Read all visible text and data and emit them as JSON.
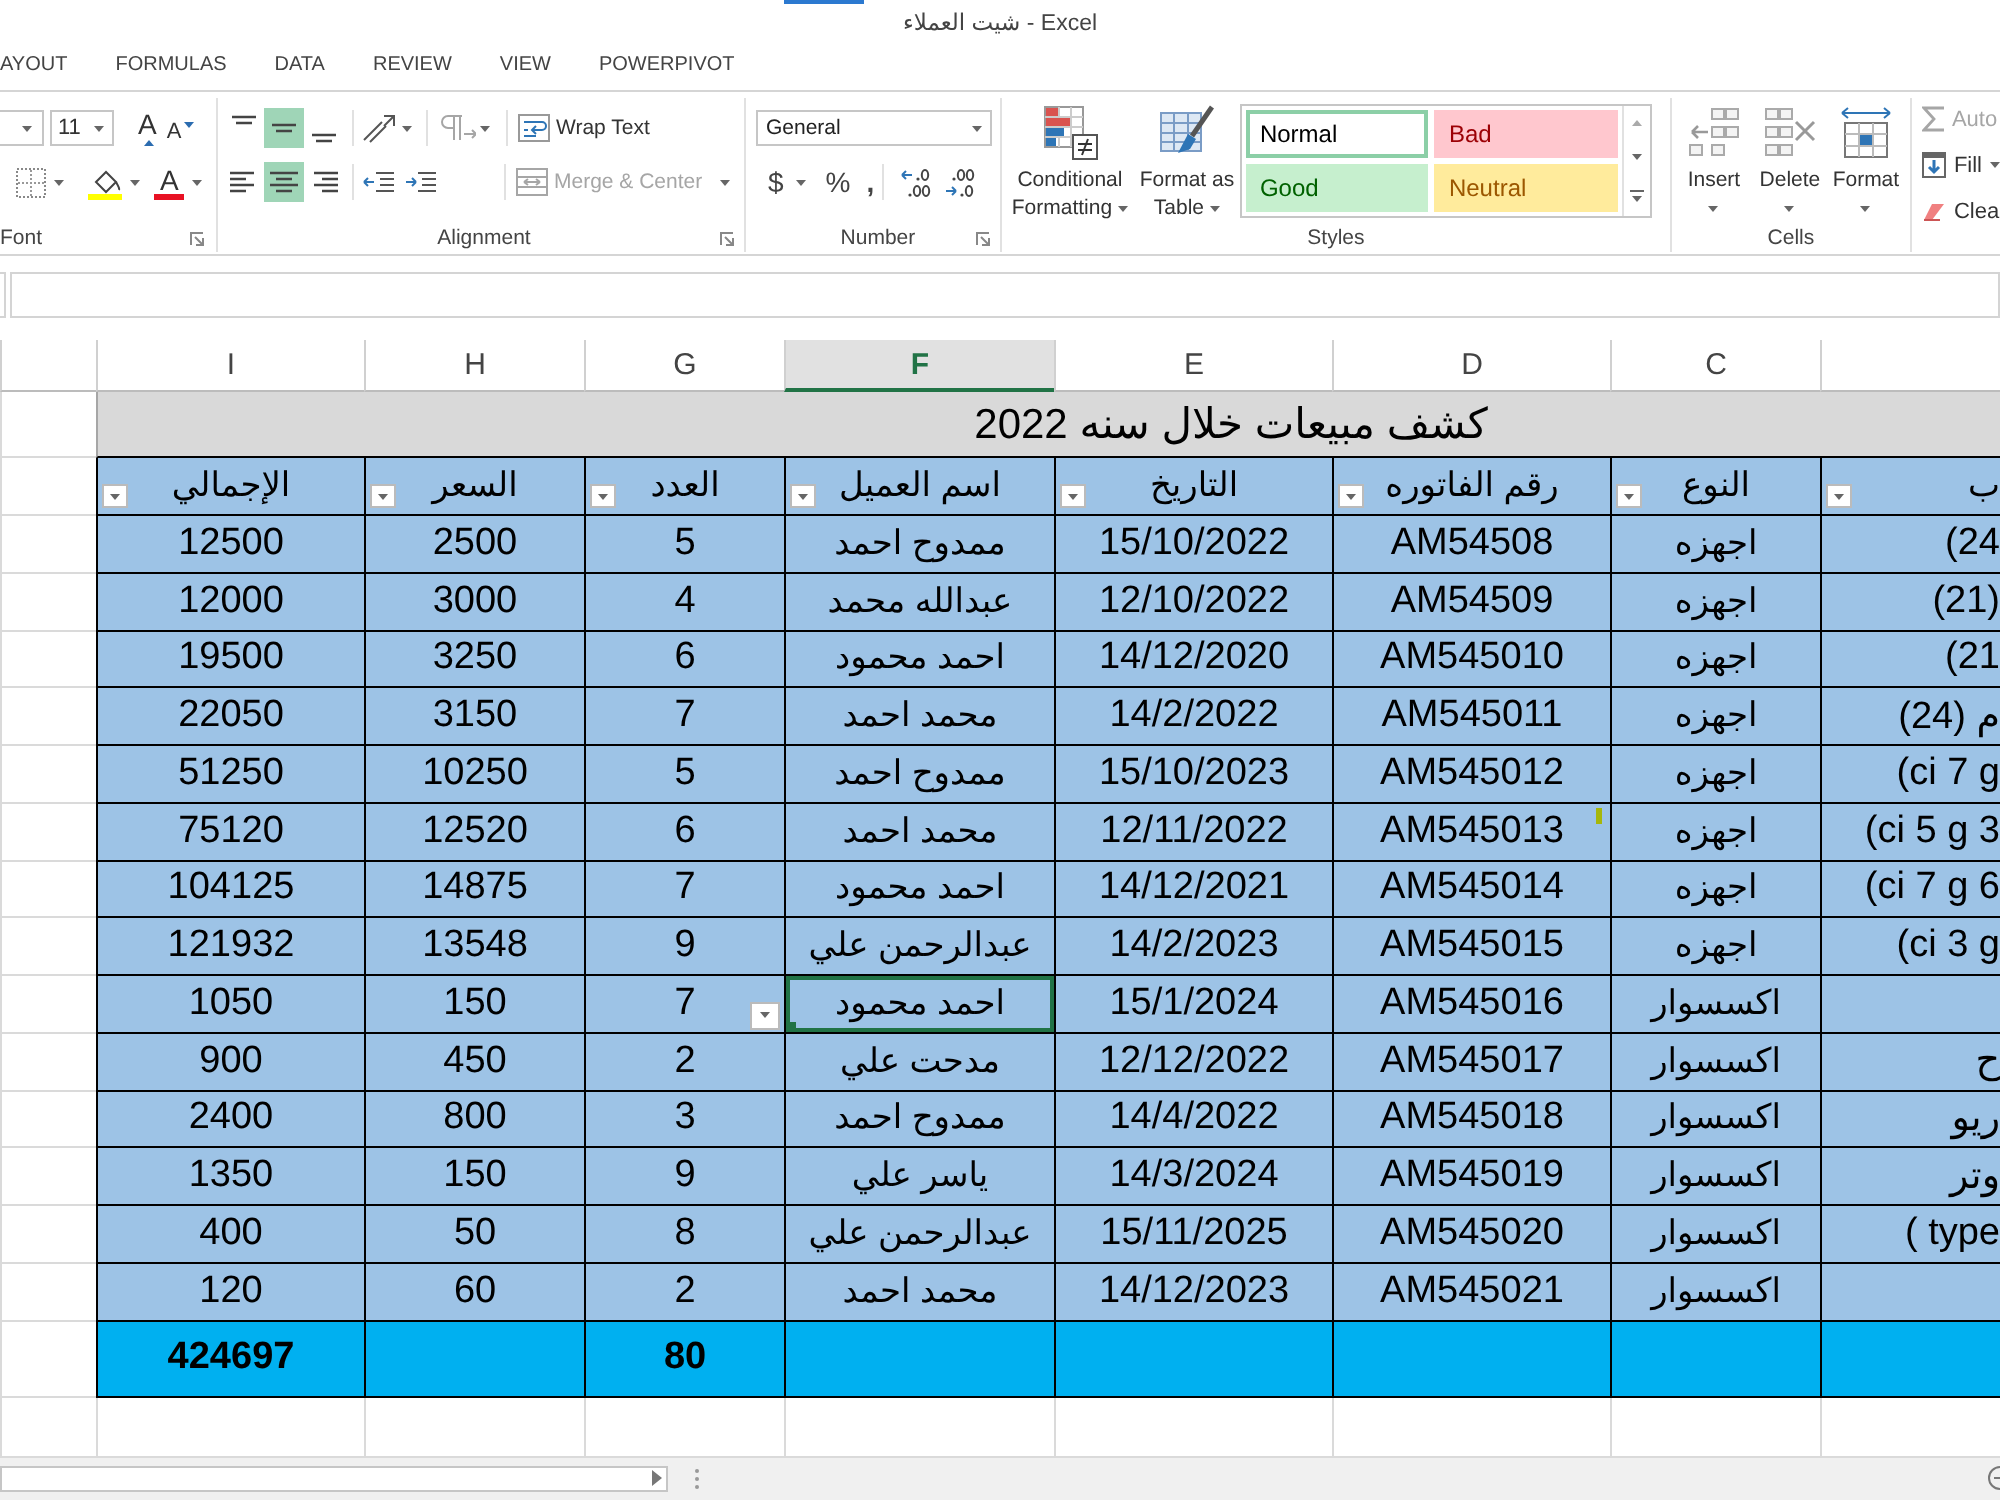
{
  "window": {
    "title": "شيت العملاء - Excel"
  },
  "ribbon_tabs": [
    {
      "label": "POWERPIVOT",
      "selected": false
    },
    {
      "label": "VIEW",
      "selected": false
    },
    {
      "label": "REVIEW",
      "selected": false
    },
    {
      "label": "DATA",
      "selected": false
    },
    {
      "label": "FORMULAS",
      "selected": false
    },
    {
      "label": "AYOUT",
      "selected": false
    }
  ],
  "ribbon": {
    "font": {
      "size": "11",
      "grow_glyph": "A",
      "shrink_glyph": "A",
      "color_glyph": "A",
      "label": "Font"
    },
    "alignment": {
      "vertical": [
        {
          "kind": "top",
          "selected": false
        },
        {
          "kind": "middle",
          "selected": true
        },
        {
          "kind": "bottom",
          "selected": false
        }
      ],
      "horizontal": [
        {
          "kind": "left",
          "selected": false
        },
        {
          "kind": "center",
          "selected": true
        },
        {
          "kind": "right",
          "selected": false
        }
      ],
      "text_direction": {
        "disabled": true
      },
      "wrap_text": "Wrap Text",
      "merge_center": {
        "label": "Merge & Center",
        "disabled": true
      },
      "label": "Alignment"
    },
    "number": {
      "format": "General",
      "currency": "$",
      "percent": "%",
      "comma": ",",
      "label": "Number"
    },
    "styles": {
      "conditional_formatting": [
        "Conditional",
        "Formatting"
      ],
      "format_as_table": [
        "Format as",
        "Table"
      ],
      "gallery": [
        {
          "label": "Bad",
          "kind": "bad",
          "selected": false
        },
        {
          "label": "Normal",
          "kind": "normal",
          "selected": true
        },
        {
          "label": "Neutral",
          "kind": "neutral",
          "selected": false
        },
        {
          "label": "Good",
          "kind": "good",
          "selected": false
        }
      ],
      "label": "Styles"
    },
    "cells": {
      "buttons": [
        {
          "label": "Format",
          "kind": "format"
        },
        {
          "label": "Delete",
          "kind": "delete"
        },
        {
          "label": "Insert",
          "kind": "insert"
        }
      ],
      "label": "Cells"
    },
    "editing": {
      "autosum": {
        "label": "Auto",
        "disabled": true
      },
      "fill": "Fill",
      "clear": "Clea"
    }
  },
  "sheet": {
    "columns": [
      {
        "letter": "C",
        "selected": false
      },
      {
        "letter": "D",
        "selected": false
      },
      {
        "letter": "E",
        "selected": false
      },
      {
        "letter": "F",
        "selected": true
      },
      {
        "letter": "G",
        "selected": false
      },
      {
        "letter": "H",
        "selected": false
      },
      {
        "letter": "I",
        "selected": false
      }
    ],
    "title": "كشف مبيعات خلال سنه 2022",
    "headers": [
      "ب",
      "النوع",
      "رقم الفاتوره",
      "التاريخ",
      "اسم العميل",
      "العدد",
      "السعر",
      "الإجمالي"
    ],
    "rows": [
      {
        "column_b": "(24",
        "type": "اجهزه",
        "invoice_number": "AM54508",
        "date": "15/10/2022",
        "customer_name": "ممدوح احمد",
        "count": "5",
        "price": "2500",
        "total": "12500",
        "selected": false,
        "error_mark": false
      },
      {
        "column_b": "(21)",
        "type": "اجهزه",
        "invoice_number": "AM54509",
        "date": "12/10/2022",
        "customer_name": "عبدالله محمد",
        "count": "4",
        "price": "3000",
        "total": "12000",
        "selected": false,
        "error_mark": false
      },
      {
        "column_b": "(21",
        "type": "اجهزه",
        "invoice_number": "AM545010",
        "date": "14/12/2020",
        "customer_name": "احمد محمود",
        "count": "6",
        "price": "3250",
        "total": "19500",
        "selected": false,
        "error_mark": false
      },
      {
        "column_b": "م (24)",
        "type": "اجهزه",
        "invoice_number": "AM545011",
        "date": "14/2/2022",
        "customer_name": "محمد احمد",
        "count": "7",
        "price": "3150",
        "total": "22050",
        "selected": false,
        "error_mark": false
      },
      {
        "column_b": "(ci 7 g",
        "type": "اجهزه",
        "invoice_number": "AM545012",
        "date": "15/10/2023",
        "customer_name": "ممدوح احمد",
        "count": "5",
        "price": "10250",
        "total": "51250",
        "selected": false,
        "error_mark": false
      },
      {
        "column_b": "(ci 5 g 3",
        "type": "اجهزه",
        "invoice_number": "AM545013",
        "date": "12/11/2022",
        "customer_name": "محمد احمد",
        "count": "6",
        "price": "12520",
        "total": "75120",
        "selected": false,
        "error_mark": true
      },
      {
        "column_b": "(ci 7 g 6",
        "type": "اجهزه",
        "invoice_number": "AM545014",
        "date": "14/12/2021",
        "customer_name": "احمد محمود",
        "count": "7",
        "price": "14875",
        "total": "104125",
        "selected": false,
        "error_mark": false
      },
      {
        "column_b": "(ci 3 g",
        "type": "اجهزه",
        "invoice_number": "AM545015",
        "date": "14/2/2023",
        "customer_name": "عبدالرحمن علي",
        "count": "9",
        "price": "13548",
        "total": "121932",
        "selected": false,
        "error_mark": false
      },
      {
        "type": "اكسسوار",
        "invoice_number": "AM545016",
        "date": "15/1/2024",
        "customer_name": "احمد محمود",
        "count": "7",
        "price": "150",
        "total": "1050",
        "selected": true,
        "error_mark": false
      },
      {
        "column_b": "ح",
        "type": "اكسسوار",
        "invoice_number": "AM545017",
        "date": "12/12/2022",
        "customer_name": "مدحت علي",
        "count": "2",
        "price": "450",
        "total": "900",
        "selected": false,
        "error_mark": false
      },
      {
        "column_b": "ريو",
        "type": "اكسسوار",
        "invoice_number": "AM545018",
        "date": "14/4/2022",
        "customer_name": "ممدوح احمد",
        "count": "3",
        "price": "800",
        "total": "2400",
        "selected": false,
        "error_mark": false
      },
      {
        "column_b": "وتر",
        "type": "اكسسوار",
        "invoice_number": "AM545019",
        "date": "14/3/2024",
        "customer_name": "ياسر علي",
        "count": "9",
        "price": "150",
        "total": "1350",
        "selected": false,
        "error_mark": false
      },
      {
        "column_b": "( type",
        "type": "اكسسوار",
        "invoice_number": "AM545020",
        "date": "15/11/2025",
        "customer_name": "عبدالرحمن علي",
        "count": "8",
        "price": "50",
        "total": "400",
        "selected": false,
        "error_mark": false
      },
      {
        "type": "اكسسوار",
        "invoice_number": "AM545021",
        "date": "14/12/2023",
        "customer_name": "محمد احمد",
        "count": "2",
        "price": "60",
        "total": "120",
        "selected": false,
        "error_mark": false
      }
    ],
    "totals": {
      "count": "80",
      "total": "424697"
    }
  }
}
